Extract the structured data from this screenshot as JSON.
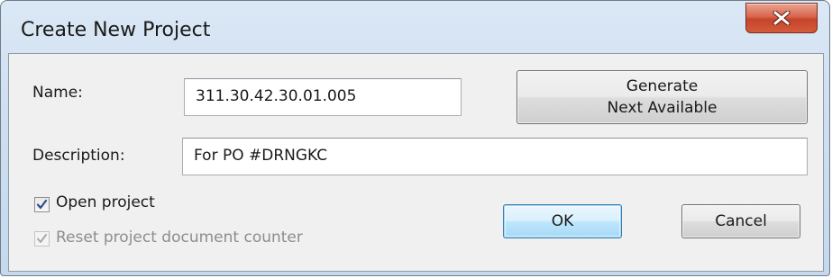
{
  "window": {
    "title": "Create New Project",
    "close_icon": "close-x-icon",
    "accent_close_color": "#c5452a"
  },
  "form": {
    "name_label": "Name:",
    "name_value": "311.30.42.30.01.005",
    "description_label": "Description:",
    "description_value": "For PO #DRNGKC"
  },
  "buttons": {
    "generate_line1": "Generate",
    "generate_line2": "Next Available",
    "ok_label": "OK",
    "cancel_label": "Cancel"
  },
  "options": {
    "open_project_label": "Open project",
    "open_project_checked": true,
    "reset_counter_label": "Reset project document counter",
    "reset_counter_checked": true,
    "reset_counter_enabled": false
  }
}
